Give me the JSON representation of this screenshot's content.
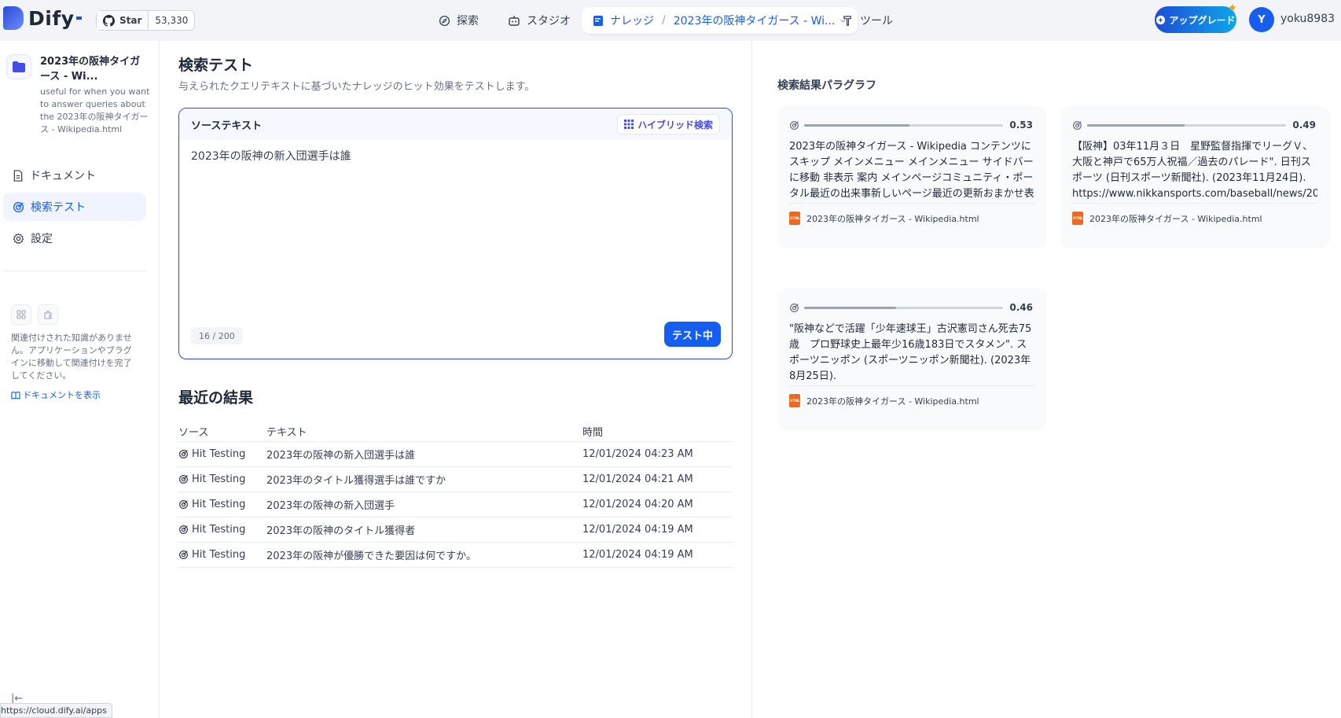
{
  "header": {
    "logo_text": "Dify",
    "github_star_label": "Star",
    "github_star_count": "53,330",
    "nav": {
      "explore": "探索",
      "studio": "スタジオ",
      "knowledge": "ナレッジ",
      "knowledge_current": "2023年の阪神タイガース - Wi...",
      "tools": "ツール"
    },
    "upgrade_label": "アップグレード",
    "avatar_initial": "Y",
    "username": "yoku8983"
  },
  "sidebar": {
    "kb_title": "2023年の阪神タイガース - Wi...",
    "kb_description": "useful for when you want to answer queries about the 2023年の阪神タイガース - Wikipedia.html",
    "items": [
      {
        "label": "ドキュメント",
        "icon": "document-icon"
      },
      {
        "label": "検索テスト",
        "icon": "target-icon"
      },
      {
        "label": "設定",
        "icon": "gear-icon"
      }
    ],
    "note": "関連付けされた知識がありません。アプリケーションやプラグインに移動して関連付けを完了してください。",
    "docs_link": "ドキュメントを表示",
    "status_url": "https://cloud.dify.ai/apps"
  },
  "main": {
    "title": "検索テスト",
    "subtitle": "与えられたクエリテキストに基づいたナレッジのヒット効果をテストします。",
    "source_label": "ソーステキスト",
    "hybrid_label": "ハイブリッド検索",
    "query": "2023年の阪神の新入団選手は誰",
    "char_count": "16",
    "char_limit": "200",
    "test_button": "テスト中",
    "recent_title": "最近の結果",
    "table_headers": {
      "source": "ソース",
      "text": "テキスト",
      "time": "時間"
    },
    "rows": [
      {
        "source": "Hit Testing",
        "text": "2023年の阪神の新入団選手は誰",
        "time": "12/01/2024 04:23 AM"
      },
      {
        "source": "Hit Testing",
        "text": "2023年のタイトル獲得選手は誰ですか",
        "time": "12/01/2024 04:21 AM"
      },
      {
        "source": "Hit Testing",
        "text": "2023年の阪神の新入団選手",
        "time": "12/01/2024 04:20 AM"
      },
      {
        "source": "Hit Testing",
        "text": "2023年の阪神のタイトル獲得者",
        "time": "12/01/2024 04:19 AM"
      },
      {
        "source": "Hit Testing",
        "text": "2023年の阪神が優勝できた要因は何ですか。",
        "time": "12/01/2024 04:19 AM"
      }
    ]
  },
  "results": {
    "title": "検索結果パラグラフ",
    "cards": [
      {
        "score": "0.53",
        "score_value": 0.53,
        "text": "2023年の阪神タイガース - Wikipedia コンテンツにスキップ メインメニュー メインメニュー サイドバーに移動 非表示 案内 メインページコミュニティ・ポータル最近の出来事新しいページ最近の更新おまかせ表示練習用ページアップロード",
        "file": "2023年の阪神タイガース - Wikipedia.html"
      },
      {
        "score": "0.49",
        "score_value": 0.49,
        "text": "【阪神】03年11月３日　星野監督指揮でリーグＶ、大阪と神戸で65万人祝福／過去のパレード\". 日刊スポーツ (日刊スポーツ新聞社). (2023年11月24日). https://www.nikkansports.com/baseball/news/20",
        "file": "2023年の阪神タイガース - Wikipedia.html"
      },
      {
        "score": "0.46",
        "score_value": 0.46,
        "text": "\"阪神などで活躍「少年速球王」古沢憲司さん死去75歳　プロ野球史上最年少16歳183日でスタメン\". スポーツニッポン (スポーツニッポン新聞社). (2023年8月25日).",
        "file": "2023年の阪神タイガース - Wikipedia.html"
      }
    ]
  }
}
